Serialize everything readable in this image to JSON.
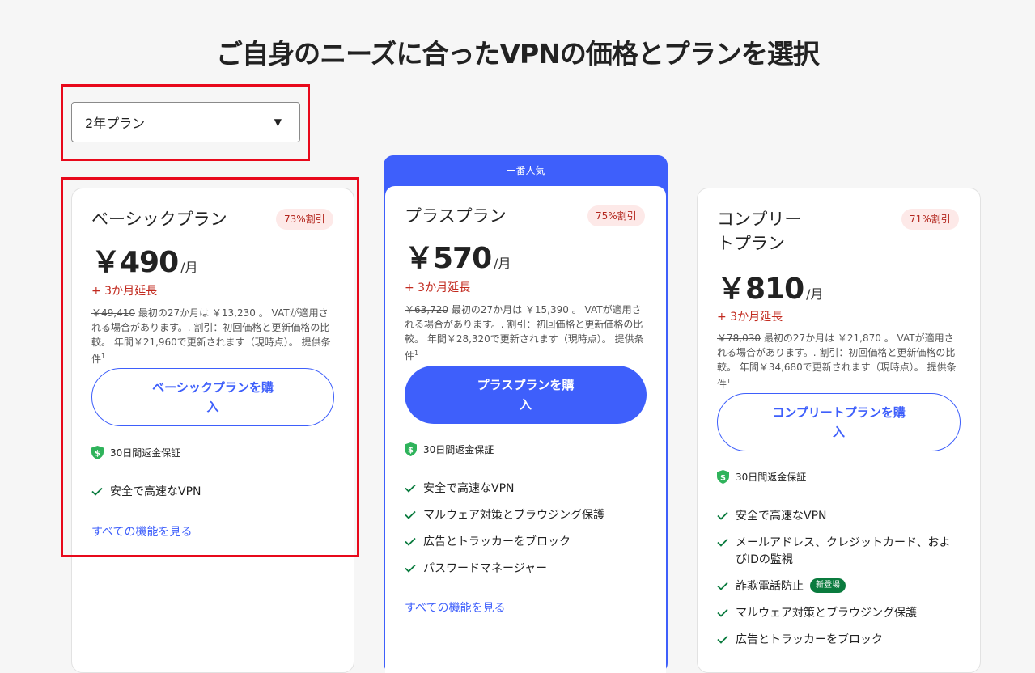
{
  "page_title": "ご自身のニーズに合ったVPNの価格とプランを選択",
  "plan_select": {
    "value": "2年プラン",
    "arrow": "▼"
  },
  "plans": [
    {
      "name": "ベーシックプラン",
      "discount": "73%割引",
      "price": "￥490",
      "per": "/月",
      "extension": "+ 3か月延長",
      "original_price": "￥49,410",
      "fine_1": " 最初の27か月は ￥13,230 。 VATが適用される場合があります。. 割引：初回価格と更新価格の比較。 年間￥21,960で更新されます（現時点）。 提供条件",
      "footnote": "1",
      "button": "ベーシックプランを購入",
      "guarantee": "30日間返金保証",
      "features": [
        "安全で高速なVPN"
      ],
      "see_all": "すべての機能を見る"
    },
    {
      "popular_label": "一番人気",
      "name": "プラスプラン",
      "discount": "75%割引",
      "price": "￥570",
      "per": "/月",
      "extension": "+ 3か月延長",
      "original_price": "￥63,720",
      "fine_1": " 最初の27か月は ￥15,390 。 VATが適用される場合があります。. 割引：初回価格と更新価格の比較。 年間￥28,320で更新されます（現時点）。 提供条件",
      "footnote": "1",
      "button": "プラスプランを購入",
      "guarantee": "30日間返金保証",
      "features": [
        "安全で高速なVPN",
        "マルウェア対策とブラウジング保護",
        "広告とトラッカーをブロック",
        "パスワードマネージャー"
      ],
      "see_all": "すべての機能を見る"
    },
    {
      "name": "コンプリートプラン",
      "discount": "71%割引",
      "price": "￥810",
      "per": "/月",
      "extension": "+ 3か月延長",
      "original_price": "￥78,030",
      "fine_1": " 最初の27か月は ￥21,870 。 VATが適用される場合があります。. 割引：初回価格と更新価格の比較。 年間￥34,680で更新されます（現時点）。 提供条件",
      "footnote": "1",
      "button": "コンプリートプランを購入",
      "guarantee": "30日間返金保証",
      "features": [
        "安全で高速なVPN",
        "メールアドレス、クレジットカード、およびIDの監視",
        "詐欺電話防止",
        "マルウェア対策とブラウジング保護",
        "広告とトラッカーをブロック"
      ],
      "new_badge": "新登場",
      "see_all": ""
    }
  ],
  "colors": {
    "accent": "#3e5ffb",
    "highlight": "#e8091b",
    "discount_text": "#b3261e",
    "check": "#0a7b3e"
  }
}
